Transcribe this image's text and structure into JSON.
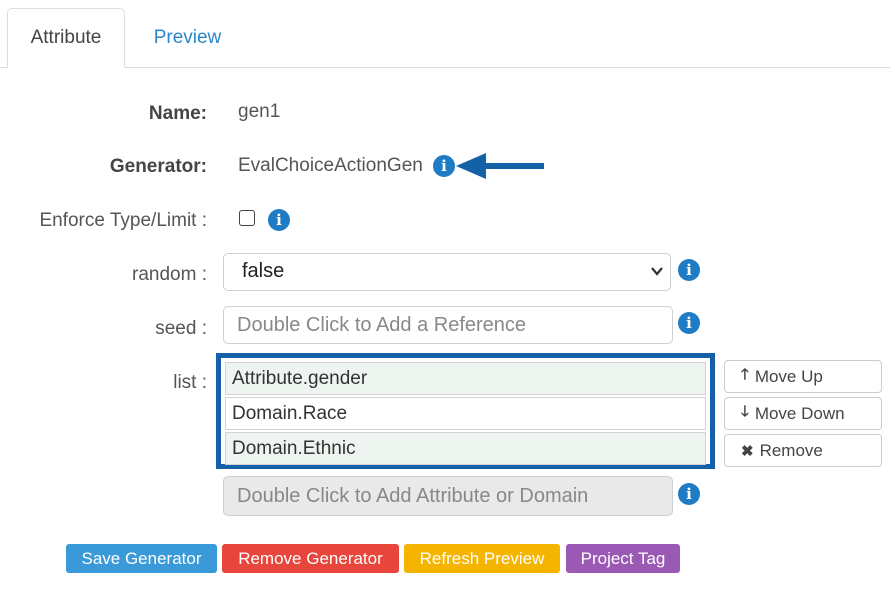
{
  "tabs": [
    {
      "label": "Attribute",
      "active": true
    },
    {
      "label": "Preview",
      "active": false
    }
  ],
  "form": {
    "name_label": "Name:",
    "name_value": "gen1",
    "generator_label": "Generator:",
    "generator_value": "EvalChoiceActionGen",
    "enforce_label": "Enforce Type/Limit :",
    "enforce_checked": false,
    "random_label": "random :",
    "random_value": "false",
    "seed_label": "seed :",
    "seed_placeholder": "Double Click to Add a Reference",
    "list_label": "list :",
    "list_items": [
      "Attribute.gender",
      "Domain.Race",
      "Domain.Ethnic"
    ],
    "add_placeholder": "Double Click to Add Attribute or Domain"
  },
  "list_buttons": {
    "move_up": "Move Up",
    "move_down": "Move Down",
    "remove": "Remove"
  },
  "actions": {
    "save": "Save Generator",
    "remove": "Remove Generator",
    "refresh": "Refresh Preview",
    "tag": "Project Tag"
  },
  "colors": {
    "info_blue": "#1f7cc4",
    "highlight_border": "#1561a8",
    "save": "#3a9ad9",
    "remove": "#e8453c",
    "refresh": "#f5b400",
    "tag": "#9b59b6"
  },
  "icons": {
    "info": "info-circle-icon",
    "move_up": "arrow-up-icon",
    "move_down": "arrow-down-icon",
    "remove": "times-icon",
    "dropdown": "chevron-down-icon",
    "annotation": "arrow-left-icon"
  }
}
